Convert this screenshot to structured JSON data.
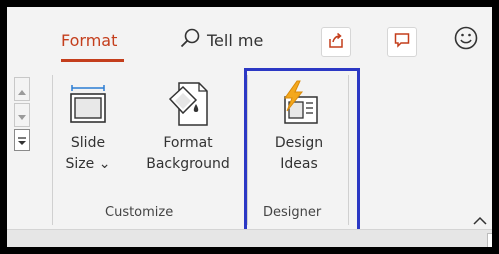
{
  "tabs": {
    "active": "Format",
    "tell_me": "Tell me"
  },
  "toolbar_icons": [
    "search-icon",
    "share-icon",
    "comments-icon",
    "smiley-icon"
  ],
  "ribbon": {
    "slide_size": {
      "line1": "Slide",
      "line2": "Size ⌄"
    },
    "format_background": {
      "line1": "Format",
      "line2": "Background"
    },
    "design_ideas": {
      "line1": "Design",
      "line2": "Ideas"
    },
    "groups": {
      "customize": "Customize",
      "designer": "Designer"
    }
  },
  "colors": {
    "accent": "#c43e1c",
    "highlight": "#2b38c4",
    "lightning": "#f4a81d"
  }
}
